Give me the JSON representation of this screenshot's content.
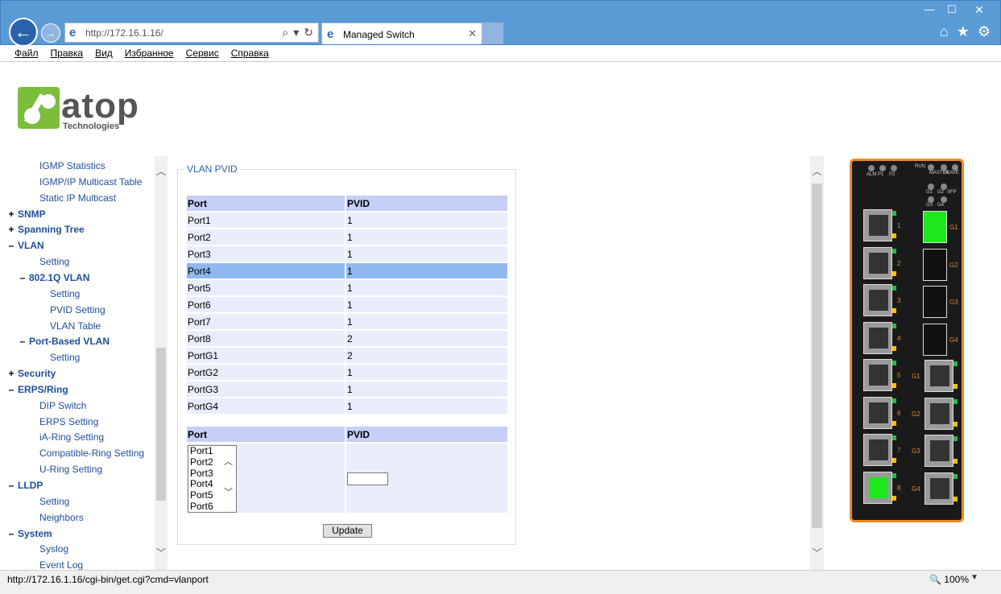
{
  "browser": {
    "url": "http://172.16.1.16/",
    "tab_title": "Managed Switch",
    "menu": [
      "Файл",
      "Правка",
      "Вид",
      "Избранное",
      "Сервис",
      "Справка"
    ],
    "status_url": "http://172.16.1.16/cgi-bin/get.cgi?cmd=vlanport",
    "zoom": "100%"
  },
  "logo": {
    "brand": "atop",
    "sub": "Technologies"
  },
  "nav": [
    {
      "sign": "",
      "label": "IGMP Statistics",
      "level": 2,
      "bold": false
    },
    {
      "sign": "",
      "label": "IGMP/IP Multicast Table",
      "level": 2,
      "bold": false
    },
    {
      "sign": "",
      "label": "Static IP Multicast",
      "level": 2,
      "bold": false
    },
    {
      "sign": "+",
      "label": "SNMP",
      "level": 1,
      "bold": true
    },
    {
      "sign": "+",
      "label": "Spanning Tree",
      "level": 1,
      "bold": true
    },
    {
      "sign": "–",
      "label": "VLAN",
      "level": 1,
      "bold": true
    },
    {
      "sign": "",
      "label": "Setting",
      "level": 2,
      "bold": false
    },
    {
      "sign": "–",
      "label": "802.1Q VLAN",
      "level": 2,
      "bold": true
    },
    {
      "sign": "",
      "label": "Setting",
      "level": 3,
      "bold": false
    },
    {
      "sign": "",
      "label": "PVID Setting",
      "level": 3,
      "bold": false
    },
    {
      "sign": "",
      "label": "VLAN Table",
      "level": 3,
      "bold": false
    },
    {
      "sign": "–",
      "label": "Port-Based VLAN",
      "level": 2,
      "bold": true
    },
    {
      "sign": "",
      "label": "Setting",
      "level": 3,
      "bold": false
    },
    {
      "sign": "+",
      "label": "Security",
      "level": 1,
      "bold": true
    },
    {
      "sign": "–",
      "label": "ERPS/Ring",
      "level": 1,
      "bold": true
    },
    {
      "sign": "",
      "label": "DIP Switch",
      "level": 2,
      "bold": false
    },
    {
      "sign": "",
      "label": "ERPS Setting",
      "level": 2,
      "bold": false
    },
    {
      "sign": "",
      "label": "iA-Ring Setting",
      "level": 2,
      "bold": false
    },
    {
      "sign": "",
      "label": "Compatible-Ring Setting",
      "level": 2,
      "bold": false
    },
    {
      "sign": "",
      "label": "U-Ring Setting",
      "level": 2,
      "bold": false
    },
    {
      "sign": "–",
      "label": "LLDP",
      "level": 1,
      "bold": true
    },
    {
      "sign": "",
      "label": "Setting",
      "level": 2,
      "bold": false
    },
    {
      "sign": "",
      "label": "Neighbors",
      "level": 2,
      "bold": false
    },
    {
      "sign": "–",
      "label": "System",
      "level": 1,
      "bold": true
    },
    {
      "sign": "",
      "label": "Syslog",
      "level": 2,
      "bold": false
    },
    {
      "sign": "",
      "label": "Event Log",
      "level": 2,
      "bold": false
    }
  ],
  "main": {
    "legend": "VLAN PVID",
    "headers": {
      "port": "Port",
      "pvid": "PVID"
    },
    "rows": [
      {
        "port": "Port1",
        "pvid": "1"
      },
      {
        "port": "Port2",
        "pvid": "1"
      },
      {
        "port": "Port3",
        "pvid": "1"
      },
      {
        "port": "Port4",
        "pvid": "1",
        "selected": true
      },
      {
        "port": "Port5",
        "pvid": "1"
      },
      {
        "port": "Port6",
        "pvid": "1"
      },
      {
        "port": "Port7",
        "pvid": "1"
      },
      {
        "port": "Port8",
        "pvid": "2"
      },
      {
        "port": "PortG1",
        "pvid": "2"
      },
      {
        "port": "PortG2",
        "pvid": "1"
      },
      {
        "port": "PortG3",
        "pvid": "1"
      },
      {
        "port": "PortG4",
        "pvid": "1"
      }
    ],
    "port_options": [
      "Port1",
      "Port2",
      "Port3",
      "Port4",
      "Port5",
      "Port6"
    ],
    "pvid_value": "",
    "update_label": "Update"
  },
  "device": {
    "top_labels": [
      "ALM",
      "P1",
      "P2",
      "RUN",
      "MASTER",
      "SLAVE",
      "G1",
      "G2",
      "SFP",
      "G3",
      "G4"
    ],
    "left_port_labels": [
      "1",
      "2",
      "3",
      "4",
      "5",
      "6",
      "7",
      "8"
    ],
    "sfp_labels": [
      "G1",
      "G2",
      "G3",
      "G4"
    ],
    "right_port_labels": [
      "G1",
      "G2",
      "G3",
      "G4"
    ]
  }
}
